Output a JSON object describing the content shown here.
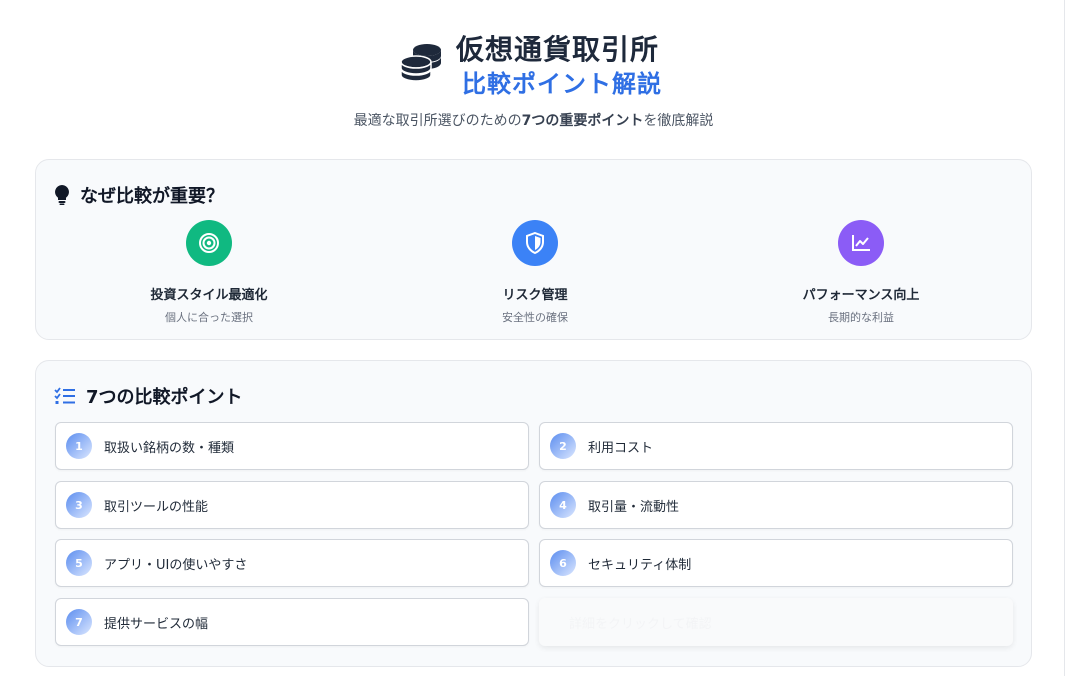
{
  "header": {
    "icon": "coins-icon",
    "title_line1": "仮想通貨取引所",
    "title_line2": "比較ポイント解説",
    "subtitle_prefix": "最適な取引所選びのための",
    "subtitle_bold": "7つの重要ポイント",
    "subtitle_suffix": "を徹底解説"
  },
  "why_section": {
    "icon": "lightbulb-icon",
    "title": "なぜ比較が重要？",
    "reasons": [
      {
        "icon": "target-icon",
        "color": "#10b981",
        "title": "投資スタイル最適化",
        "desc": "個人に合った選択"
      },
      {
        "icon": "shield-icon",
        "color": "#3b82f6",
        "title": "リスク管理",
        "desc": "安全性の確保"
      },
      {
        "icon": "chart-line-icon",
        "color": "#8b5cf6",
        "title": "パフォーマンス向上",
        "desc": "長期的な利益"
      }
    ]
  },
  "points_section": {
    "icon": "checklist-icon",
    "title": "7つの比較ポイント",
    "points": [
      {
        "num": "1",
        "label": "取扱い銘柄の数・種類"
      },
      {
        "num": "2",
        "label": "利用コスト"
      },
      {
        "num": "3",
        "label": "取引ツールの性能"
      },
      {
        "num": "4",
        "label": "取引量・流動性"
      },
      {
        "num": "5",
        "label": "アプリ・UIの使いやすさ"
      },
      {
        "num": "6",
        "label": "セキュリティ体制"
      },
      {
        "num": "7",
        "label": "提供サービスの幅"
      }
    ],
    "ghost_label": "詳細をクリックして確認"
  },
  "colors": {
    "accent_blue": "#2f6fe4",
    "green": "#10b981",
    "blue": "#3b82f6",
    "purple": "#8b5cf6"
  }
}
